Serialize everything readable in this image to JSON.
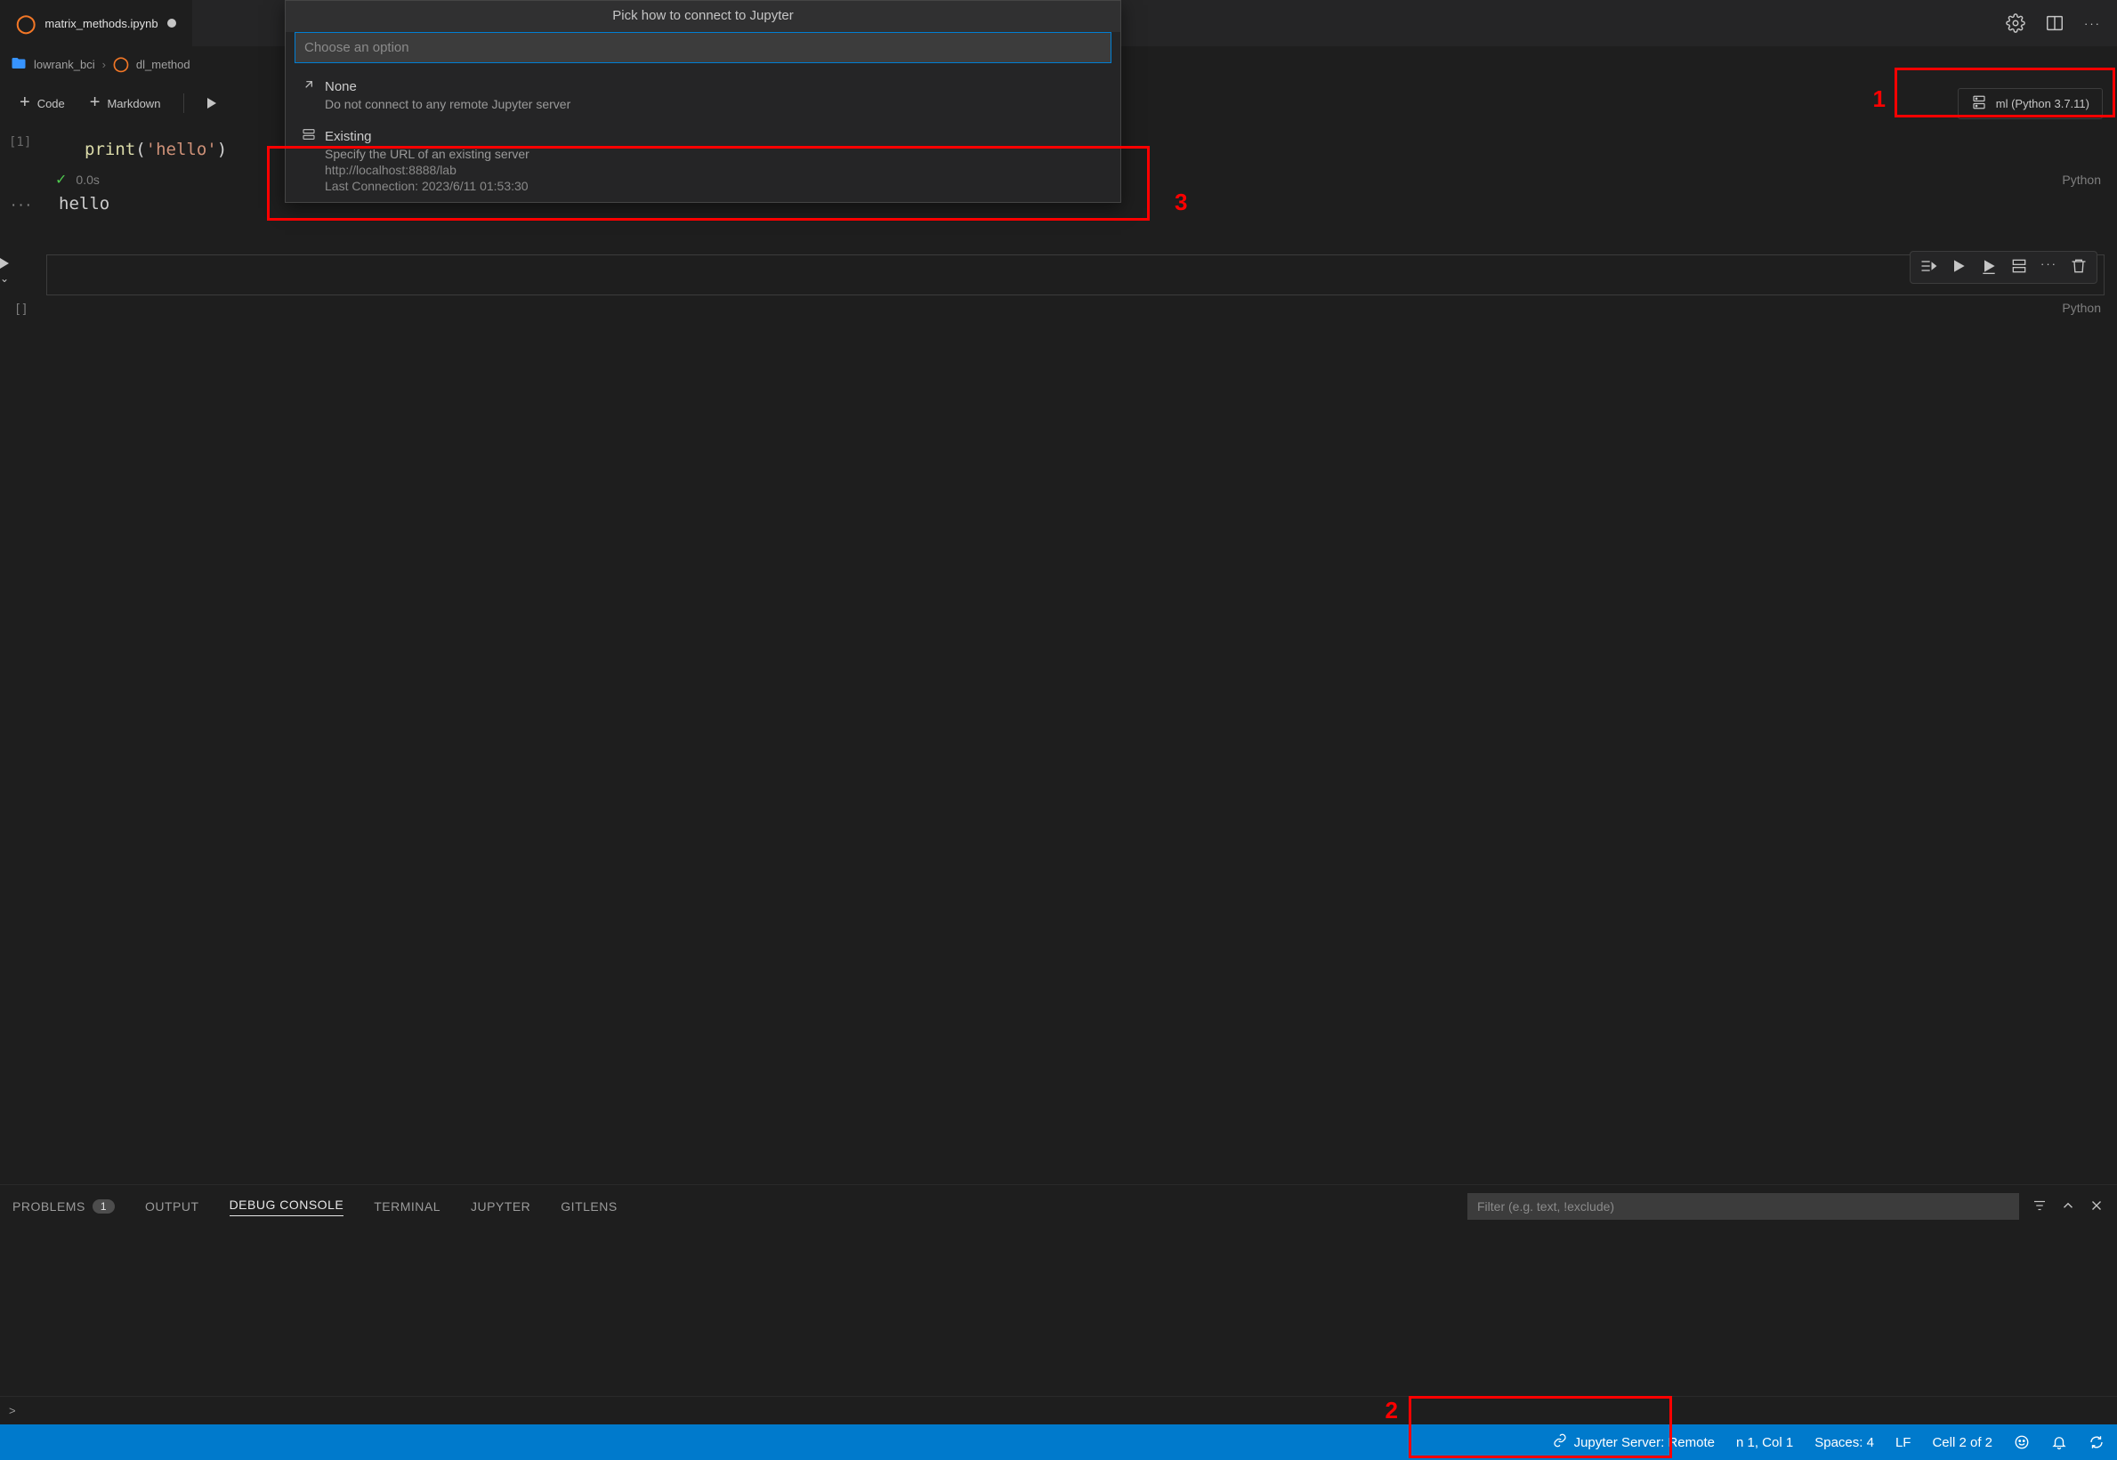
{
  "tab": {
    "filename": "matrix_methods.ipynb"
  },
  "breadcrumbs": {
    "folder": "lowrank_bci",
    "item": "dl_method"
  },
  "nb_toolbar": {
    "code": "Code",
    "markdown": "Markdown"
  },
  "kernel": {
    "label": "ml (Python 3.7.11)"
  },
  "cell1": {
    "exec_label": "[1]",
    "code_fn": "print",
    "code_open": "(",
    "code_str": "'hello'",
    "code_close": ")",
    "time": "0.0s",
    "lang": "Python",
    "output": "hello"
  },
  "cell2": {
    "exec_label": "[ ]",
    "lang": "Python"
  },
  "quickpick": {
    "title": "Pick how to connect to Jupyter",
    "placeholder": "Choose an option",
    "none": {
      "label": "None",
      "desc": "Do not connect to any remote Jupyter server"
    },
    "existing": {
      "label": "Existing",
      "desc": "Specify the URL of an existing server",
      "url": "http://localhost:8888/lab",
      "last": "Last Connection: 2023/6/11 01:53:30"
    }
  },
  "panel": {
    "problems": "PROBLEMS",
    "problems_count": "1",
    "output": "OUTPUT",
    "debug_console": "DEBUG CONSOLE",
    "terminal": "TERMINAL",
    "jupyter": "JUPYTER",
    "gitlens": "GITLENS",
    "filter_placeholder": "Filter (e.g. text, !exclude)"
  },
  "repl_prompt": ">",
  "status": {
    "jupyter": "Jupyter Server: Remote",
    "pos": "n 1, Col 1",
    "spaces": "Spaces: 4",
    "eol": "LF",
    "cell": "Cell 2 of 2"
  },
  "annotations": {
    "n1": "1",
    "n2": "2",
    "n3": "3"
  }
}
